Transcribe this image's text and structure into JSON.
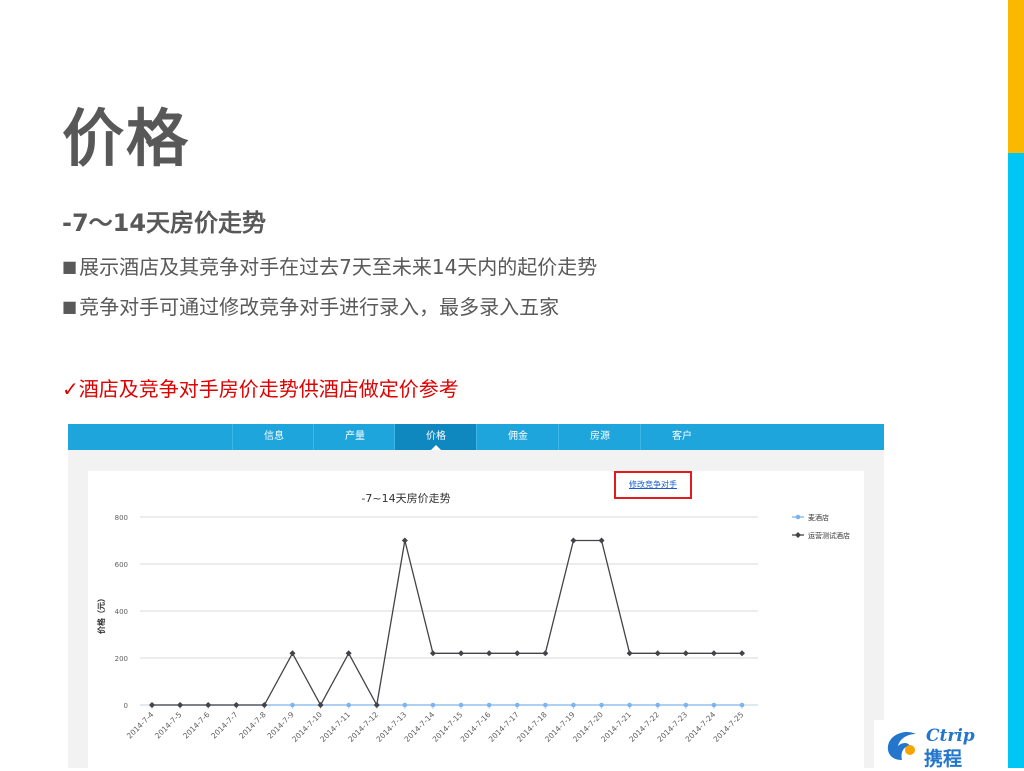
{
  "slide": {
    "title": "价格",
    "subtitle": "-7～14天房价走势",
    "bullet_mark": "■",
    "bullets": [
      "展示酒店及其竞争对手在过去7天至未来14天内的起价走势",
      "竞争对手可通过修改竞争对手进行录入，最多录入五家"
    ],
    "check_mark": "✓",
    "highlight": "酒店及竞争对手房价走势供酒店做定价参考",
    "accent_colors": {
      "yellow": "#fbb800",
      "cyan": "#00c6f5",
      "highlight": "#e00000"
    }
  },
  "screenshot": {
    "tabs": [
      {
        "label": "信息",
        "active": false
      },
      {
        "label": "产量",
        "active": false
      },
      {
        "label": "价格",
        "active": true
      },
      {
        "label": "佣金",
        "active": false
      },
      {
        "label": "房源",
        "active": false
      },
      {
        "label": "客户",
        "active": false
      }
    ],
    "edit_competitors_link": "修改竞争对手"
  },
  "logo": {
    "en": "Ctrip",
    "cn": "携程"
  },
  "chart_data": {
    "type": "line",
    "title": "-7~14天房价走势",
    "xlabel": "",
    "ylabel": "价格（元）",
    "ylim": [
      0,
      800
    ],
    "yticks": [
      0,
      200,
      400,
      600,
      800
    ],
    "grid": true,
    "legend_position": "right",
    "categories": [
      "2014-7-4",
      "2014-7-5",
      "2014-7-6",
      "2014-7-7",
      "2014-7-8",
      "2014-7-9",
      "2014-7-10",
      "2014-7-11",
      "2014-7-12",
      "2014-7-13",
      "2014-7-14",
      "2014-7-15",
      "2014-7-16",
      "2014-7-17",
      "2014-7-18",
      "2014-7-19",
      "2014-7-20",
      "2014-7-21",
      "2014-7-22",
      "2014-7-23",
      "2014-7-24",
      "2014-7-25"
    ],
    "series": [
      {
        "name": "麦酒店",
        "color": "#7cb5ec",
        "marker": "circle",
        "values": [
          0,
          0,
          0,
          0,
          0,
          0,
          0,
          0,
          0,
          0,
          0,
          0,
          0,
          0,
          0,
          0,
          0,
          0,
          0,
          0,
          0,
          0
        ]
      },
      {
        "name": "运营测试酒店",
        "color": "#434348",
        "marker": "diamond",
        "values": [
          0,
          0,
          0,
          0,
          0,
          220,
          0,
          220,
          0,
          700,
          220,
          220,
          220,
          220,
          220,
          700,
          700,
          220,
          220,
          220,
          220,
          220
        ]
      }
    ]
  }
}
